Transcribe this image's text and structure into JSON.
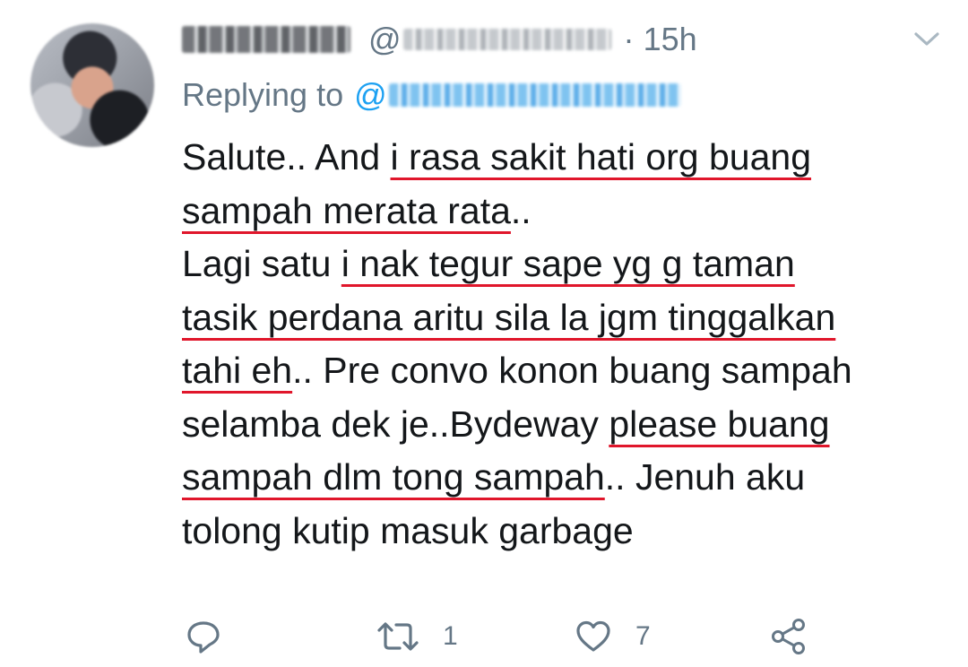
{
  "tweet": {
    "author": {
      "display_name": "",
      "handle_prefix": "@",
      "avatar": "blurred-profile-photo"
    },
    "separator": "·",
    "time": "15h",
    "reply": {
      "label": "Replying to",
      "at": "@"
    },
    "body_lines": [
      [
        {
          "t": "Salute.. And ",
          "u": false
        },
        {
          "t": "i rasa sakit hati org buang",
          "u": true
        }
      ],
      [
        {
          "t": "sampah merata rata",
          "u": true
        },
        {
          "t": "..",
          "u": false
        }
      ],
      [
        {
          "t": "Lagi satu ",
          "u": false
        },
        {
          "t": "i nak tegur sape yg g taman",
          "u": true
        }
      ],
      [
        {
          "t": "tasik perdana aritu sila la jgm tinggalkan",
          "u": true
        }
      ],
      [
        {
          "t": "tahi eh",
          "u": true
        },
        {
          "t": ".. Pre convo konon buang sampah",
          "u": false
        }
      ],
      [
        {
          "t": "selamba dek je..Bydeway ",
          "u": false
        },
        {
          "t": "please buang",
          "u": true
        }
      ],
      [
        {
          "t": "sampah dlm tong sampah",
          "u": true
        },
        {
          "t": ".. Jenuh aku",
          "u": false
        }
      ],
      [
        {
          "t": "tolong kutip masuk garbage",
          "u": false
        }
      ]
    ],
    "underline_color": "#e0162b",
    "actions": {
      "reply": {
        "icon": "reply-icon",
        "count": ""
      },
      "retweet": {
        "icon": "retweet-icon",
        "count": "1"
      },
      "like": {
        "icon": "heart-icon",
        "count": "7"
      },
      "share": {
        "icon": "share-icon",
        "count": ""
      }
    },
    "menu_icon": "chevron-down-icon"
  },
  "colors": {
    "text": "#14171a",
    "secondary": "#657786",
    "link": "#1da1f2",
    "background": "#ffffff"
  }
}
